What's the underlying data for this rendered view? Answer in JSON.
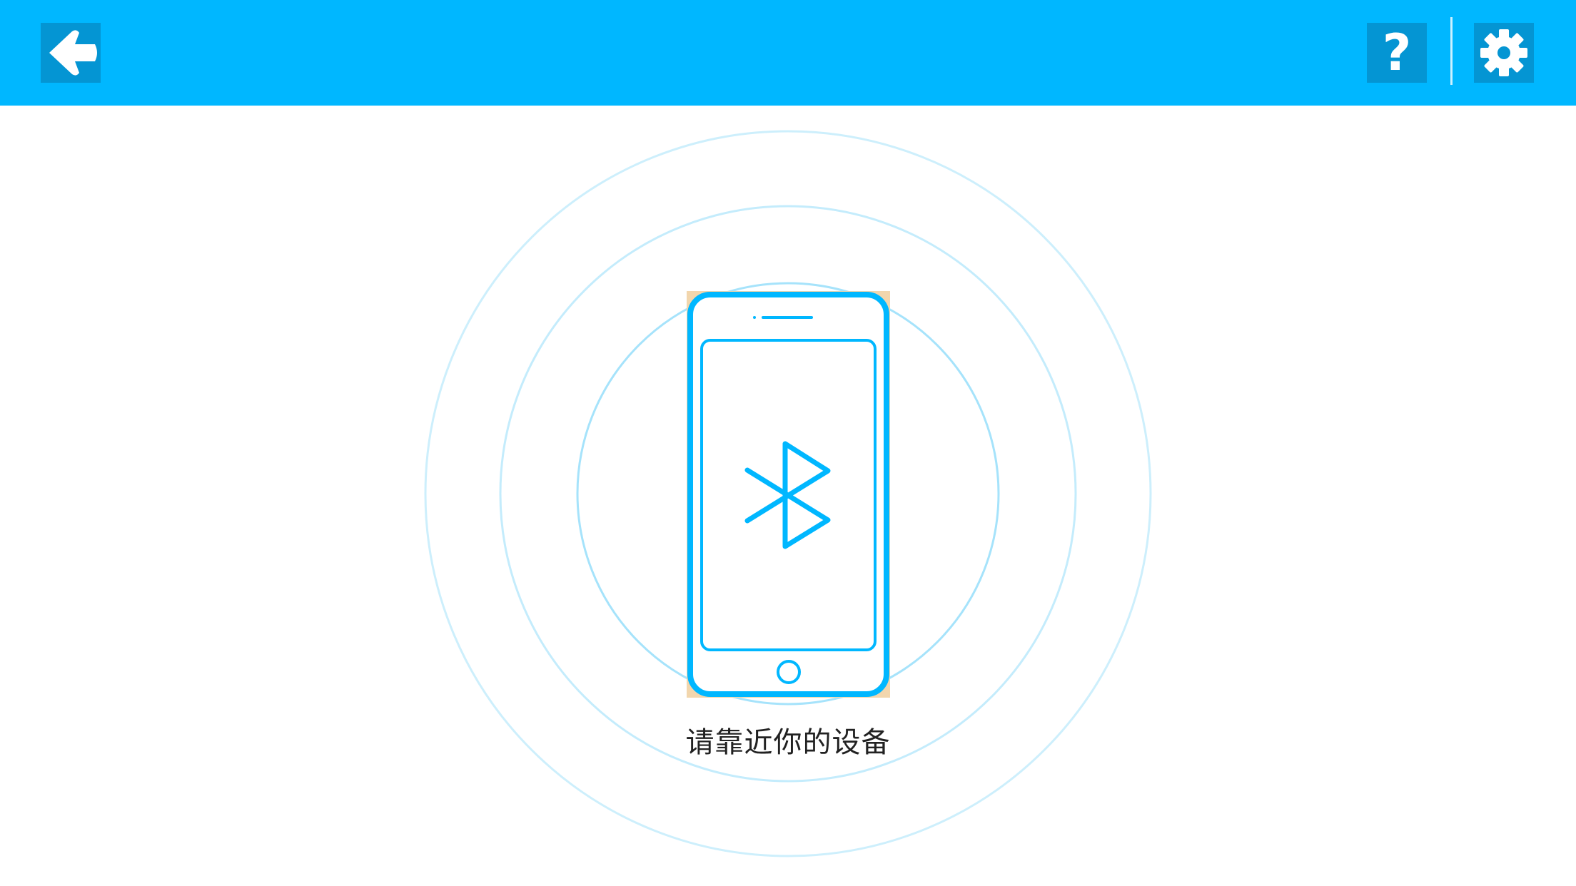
{
  "header": {
    "background_color": "#00B7FF",
    "button_color": "#0495D3",
    "back_icon": "back-arrow-icon",
    "help_icon": "question-icon",
    "help_glyph": "?",
    "settings_icon": "gear-icon"
  },
  "main": {
    "device_icon": "phone-bluetooth-icon",
    "accent_color": "#00B7FF",
    "prompt": "请靠近你的设备"
  }
}
